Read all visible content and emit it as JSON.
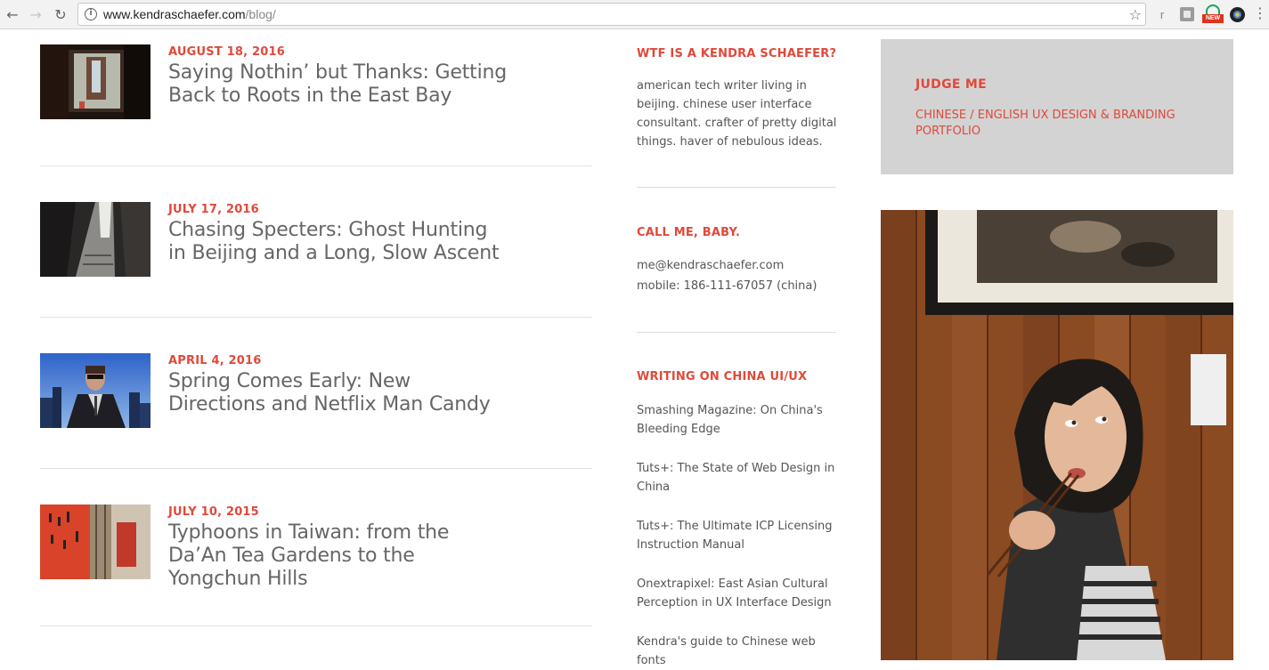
{
  "browser": {
    "url_host": "www.kendraschaefer.com",
    "url_path": "/blog/",
    "icons": [
      "back-arrow-icon",
      "forward-arrow-icon",
      "reload-icon",
      "info-icon",
      "star-icon",
      "menu-icon"
    ],
    "extensions": {
      "r_label": "r",
      "new_badge": "NEW"
    }
  },
  "posts": [
    {
      "date": "AUGUST 18, 2016",
      "title": "Saying Nothin’ but Thanks: Getting Back to Roots in the East Bay"
    },
    {
      "date": "JULY 17, 2016",
      "title": "Chasing Specters: Ghost Hunting in Beijing and a Long, Slow Ascent"
    },
    {
      "date": "APRIL 4, 2016",
      "title": "Spring Comes Early: New Directions and Netflix Man Candy"
    },
    {
      "date": "JULY 10, 2015",
      "title": "Typhoons in Taiwan: from the Da’An Tea Gardens to the Yongchun Hills"
    }
  ],
  "sidebar": {
    "about": {
      "heading": "WTF IS A KENDRA SCHAEFER?",
      "body": "american tech writer living in beijing. chinese user interface consultant. crafter of pretty digital things. haver of nebulous ideas."
    },
    "contact": {
      "heading": "CALL ME, BABY.",
      "email": "me@kendraschaefer.com",
      "mobile": "mobile: 186-111-67057 (china)"
    },
    "writing": {
      "heading": "WRITING ON CHINA UI/UX",
      "links": [
        "Smashing Magazine: On China's Bleeding Edge",
        "Tuts+: The State of Web Design in China",
        "Tuts+: The Ultimate ICP Licensing Instruction Manual",
        "Onextrapixel: East Asian Cultural Perception in UX Interface Design",
        "Kendra's guide to Chinese web fonts"
      ]
    }
  },
  "portfolio": {
    "heading": "JUDGE ME",
    "link": "CHINESE / ENGLISH UX DESIGN & BRANDING PORTFOLIO"
  },
  "colors": {
    "accent": "#e0493a",
    "text": "#555555",
    "title": "#666666",
    "panel": "#d3d3d3"
  }
}
